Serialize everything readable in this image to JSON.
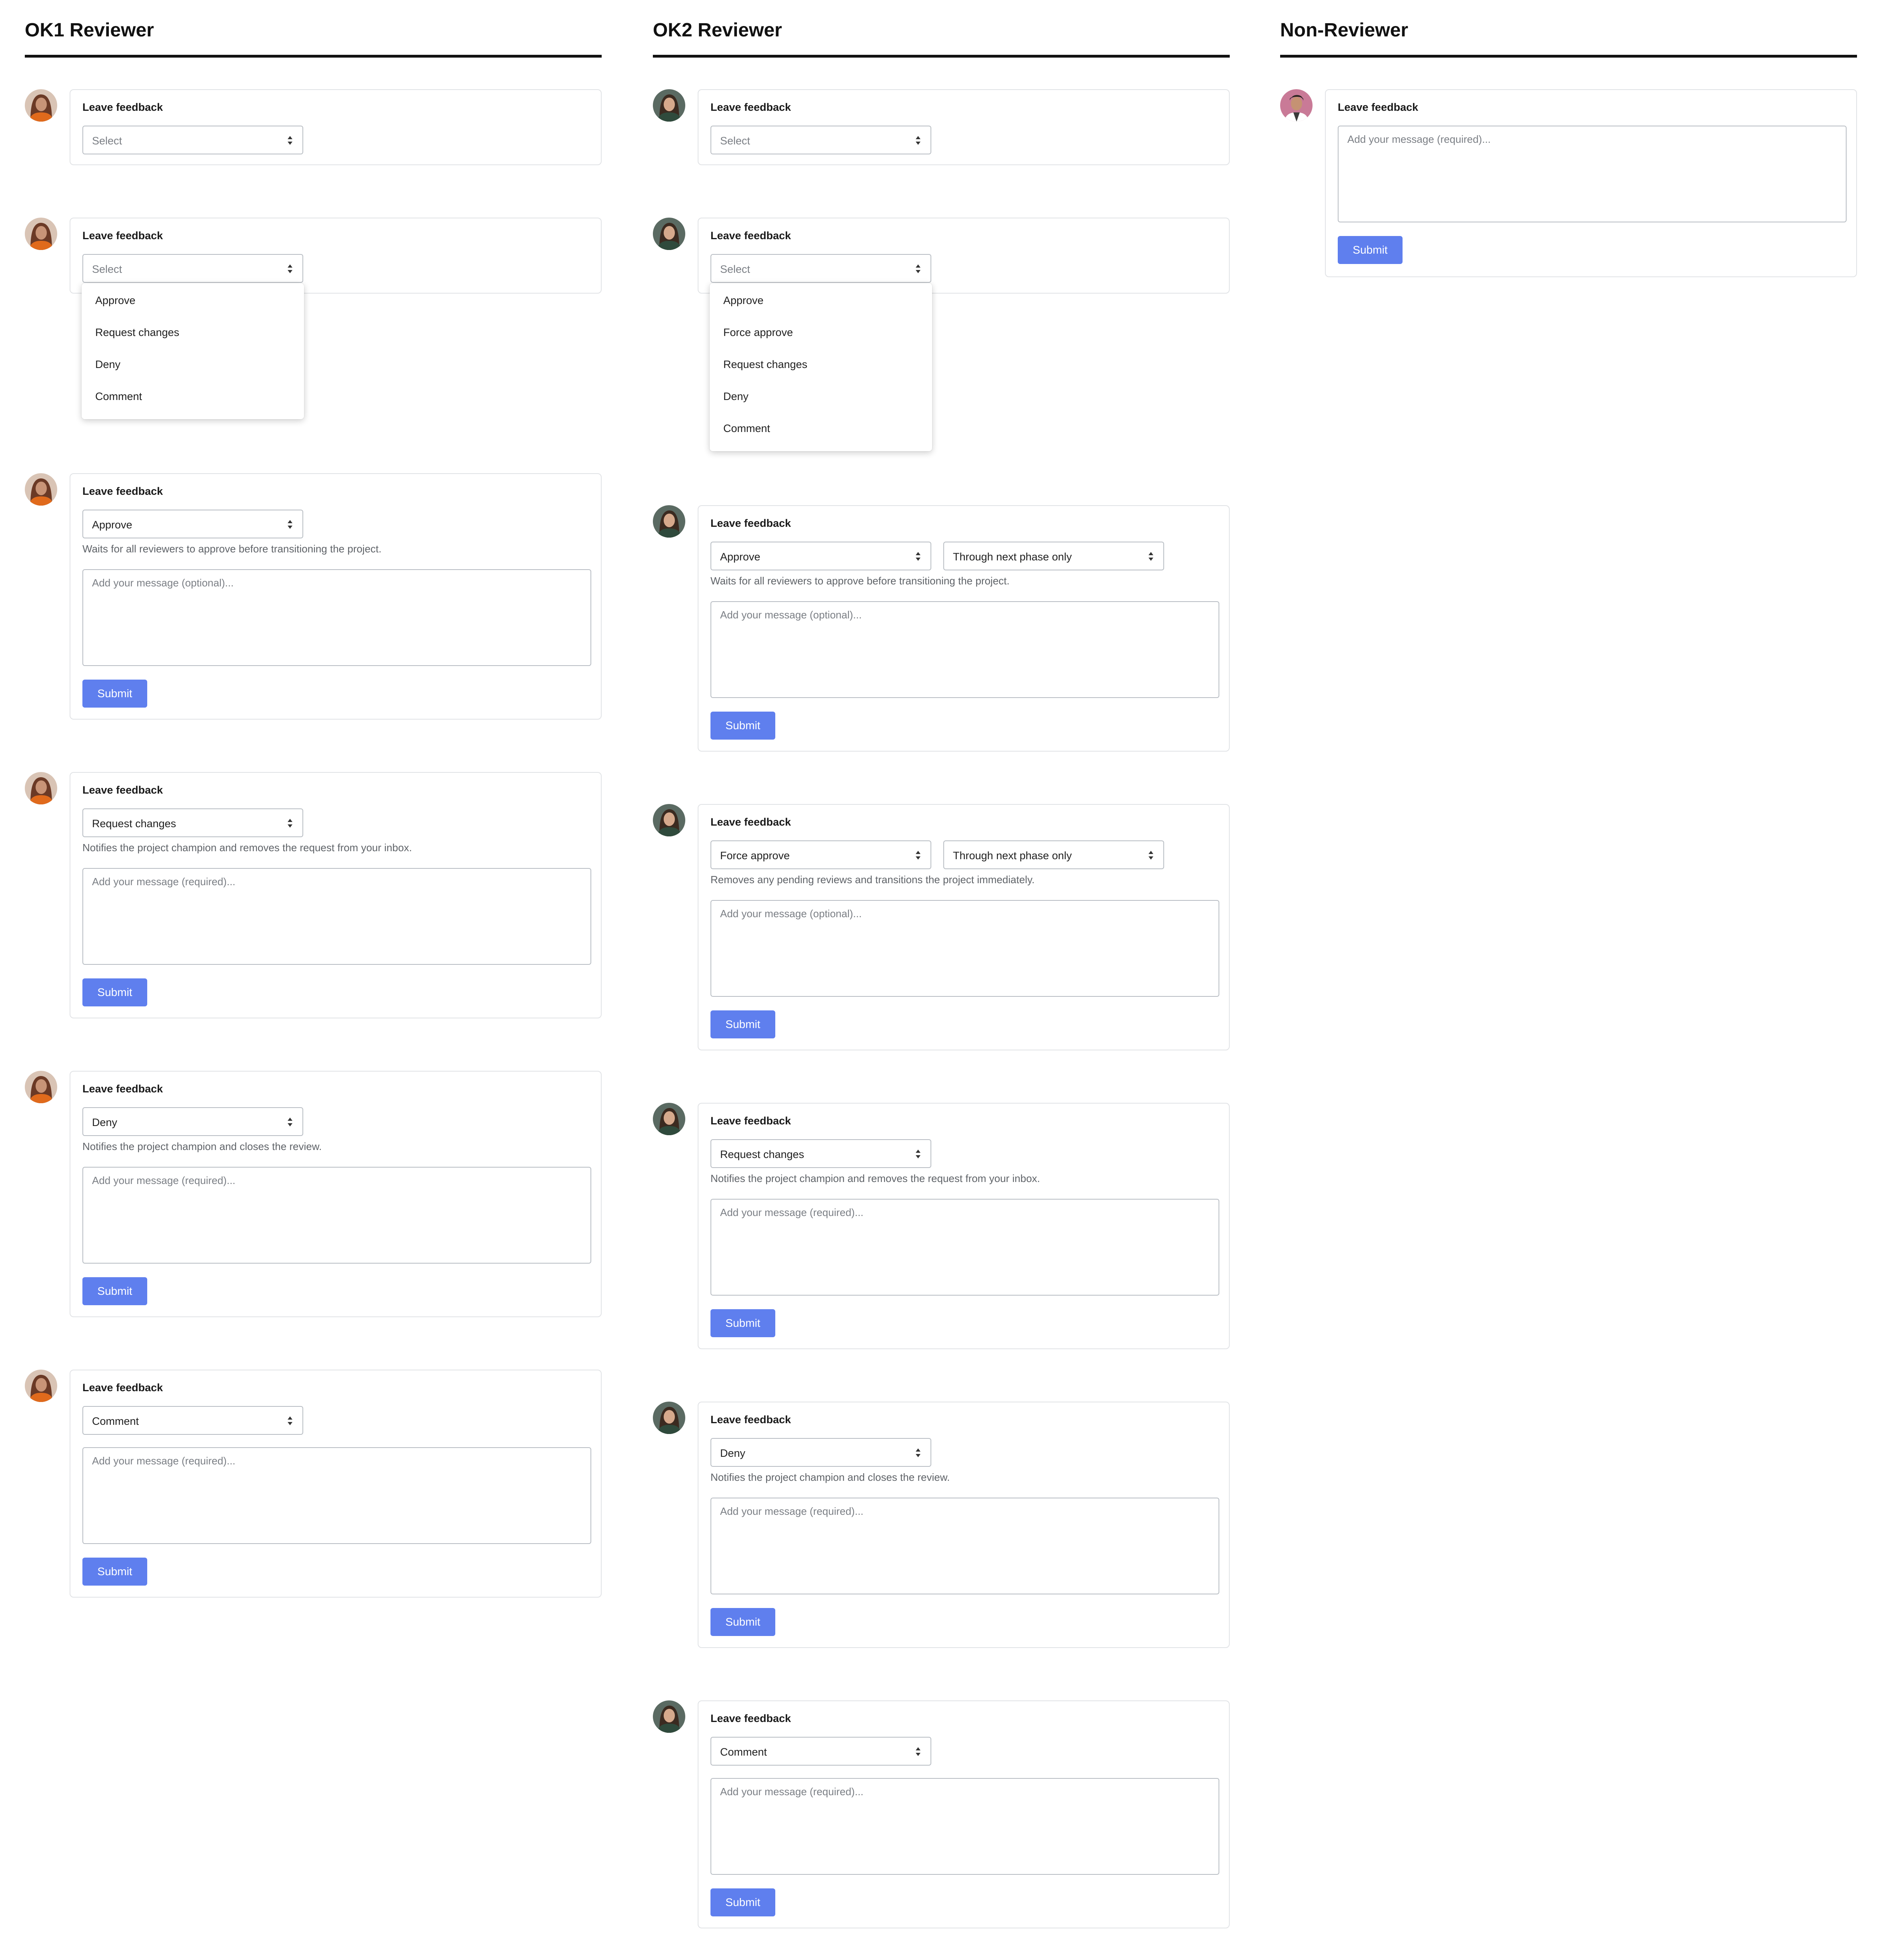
{
  "colors": {
    "submit": "#5f7fee",
    "border": "#b9bec4",
    "card_border": "#e1e3e6",
    "hint": "#5f6368"
  },
  "columns": [
    {
      "title": "OK1 Reviewer",
      "avatar_icon": "woman-portrait-icon",
      "forms": [
        {
          "title": "Leave feedback",
          "select": "Select"
        },
        {
          "title": "Leave feedback",
          "select": "Select",
          "options": [
            "Approve",
            "Request changes",
            "Deny",
            "Comment"
          ]
        },
        {
          "title": "Leave feedback",
          "select": "Approve",
          "hint": "Waits for all reviewers to approve before transitioning the project.",
          "message_placeholder": "Add your message (optional)...",
          "submit": "Submit"
        },
        {
          "title": "Leave feedback",
          "select": "Request changes",
          "hint": "Notifies the project champion and removes the request from your inbox.",
          "message_placeholder": "Add your message (required)...",
          "submit": "Submit"
        },
        {
          "title": "Leave feedback",
          "select": "Deny",
          "hint": "Notifies the project champion and closes the review.",
          "message_placeholder": "Add your message (required)...",
          "submit": "Submit"
        },
        {
          "title": "Leave feedback",
          "select": "Comment",
          "message_placeholder": "Add your message (required)...",
          "submit": "Submit"
        }
      ]
    },
    {
      "title": "OK2 Reviewer",
      "avatar_icon": "woman-portrait-icon",
      "forms": [
        {
          "title": "Leave feedback",
          "select": "Select"
        },
        {
          "title": "Leave feedback",
          "select": "Select",
          "options": [
            "Approve",
            "Force approve",
            "Request changes",
            "Deny",
            "Comment"
          ]
        },
        {
          "title": "Leave feedback",
          "select": "Approve",
          "scope": "Through next phase only",
          "hint": "Waits for all reviewers to approve before transitioning the project.",
          "message_placeholder": "Add your message (optional)...",
          "submit": "Submit"
        },
        {
          "title": "Leave feedback",
          "select": "Force approve",
          "scope": "Through next phase only",
          "hint": "Removes any pending reviews and transitions the project immediately.",
          "message_placeholder": "Add your message (optional)...",
          "submit": "Submit"
        },
        {
          "title": "Leave feedback",
          "select": "Request changes",
          "hint": "Notifies the project champion and removes the request from your inbox.",
          "message_placeholder": "Add your message (required)...",
          "submit": "Submit"
        },
        {
          "title": "Leave feedback",
          "select": "Deny",
          "hint": "Notifies the project champion and closes the review.",
          "message_placeholder": "Add your message (required)...",
          "submit": "Submit"
        },
        {
          "title": "Leave feedback",
          "select": "Comment",
          "message_placeholder": "Add your message (required)...",
          "submit": "Submit"
        }
      ]
    },
    {
      "title": "Non-Reviewer",
      "avatar_icon": "man-portrait-icon",
      "forms": [
        {
          "title": "Leave feedback",
          "message_placeholder": "Add your message (required)...",
          "submit": "Submit"
        }
      ]
    }
  ]
}
